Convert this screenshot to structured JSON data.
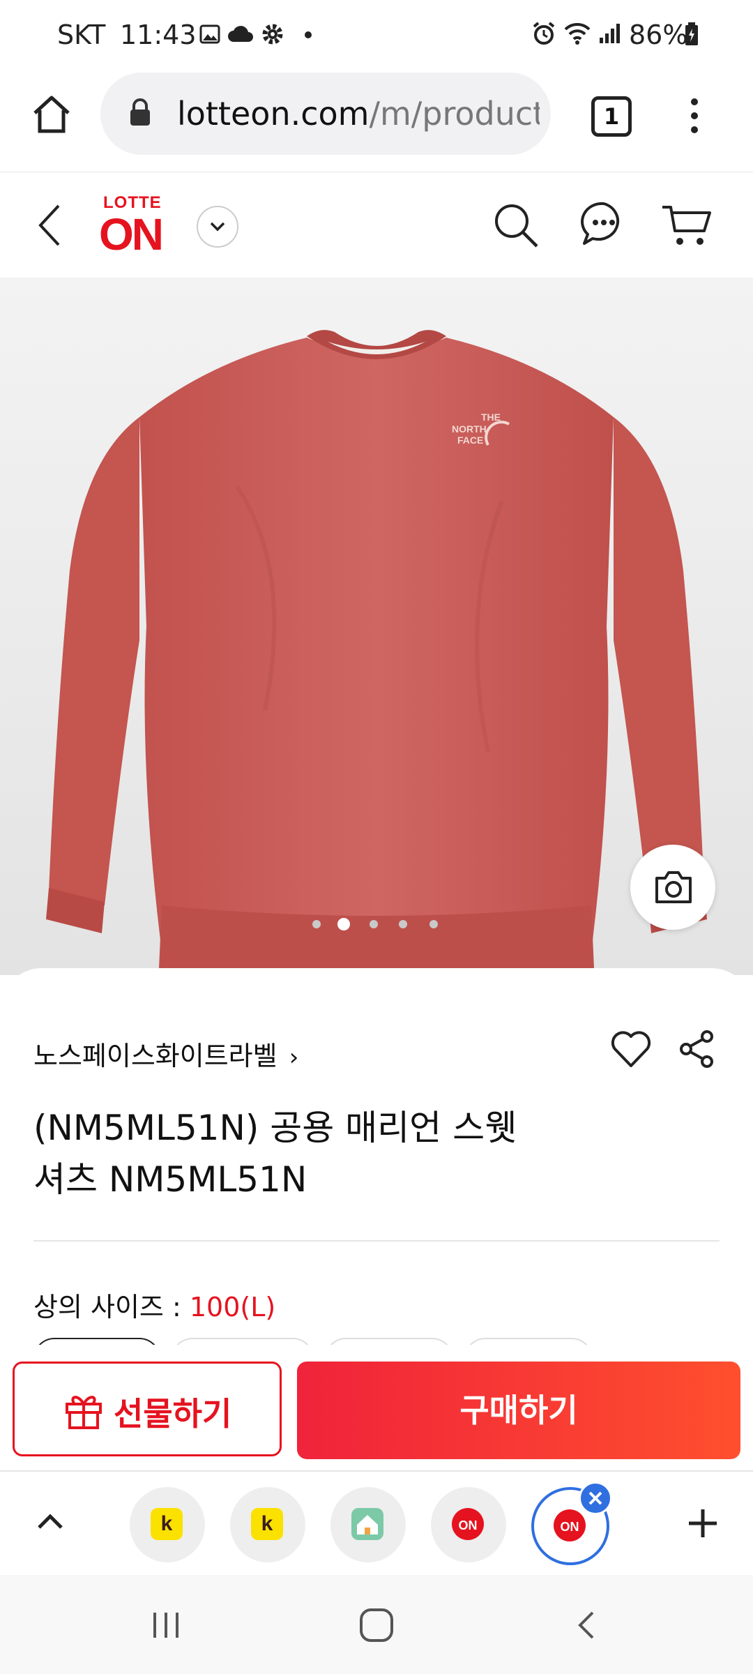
{
  "status_bar": {
    "carrier": "SKT",
    "time": "11:43",
    "battery": "86%"
  },
  "browser": {
    "url_host": "lotteon.com",
    "url_path": "/m/product/",
    "tab_count": "1"
  },
  "app_header": {
    "logo_top": "LOTTE",
    "logo_main": "ON"
  },
  "product": {
    "brand": "노스페이스화이트라벨",
    "title_line1": "(NM5ML51N) 공용 매리언 스웻",
    "title_line2": "셔츠 NM5ML51N",
    "size_label": "상의 사이즈",
    "size_value": "100(L)",
    "image_dots_total": 5,
    "image_dots_active": 2
  },
  "actions": {
    "gift_label": "선물하기",
    "buy_label": "구매하기"
  },
  "colors": {
    "accent": "#e5131f",
    "buy_gradient_start": "#f0233a",
    "buy_gradient_end": "#ff4f2e",
    "sweatshirt": "#c95f5b"
  }
}
